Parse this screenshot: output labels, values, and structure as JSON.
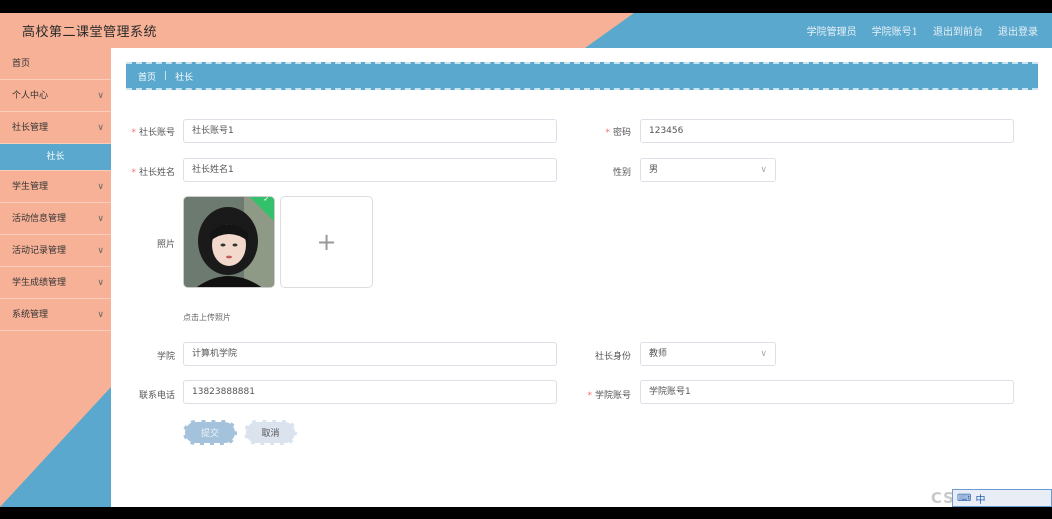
{
  "header": {
    "title": "高校第二课堂管理系统",
    "user_role": "学院管理员",
    "user_account": "学院账号1",
    "front_link": "退出到前台",
    "logout_link": "退出登录"
  },
  "sidebar": {
    "items": [
      {
        "label": "首页",
        "has_chevron": false
      },
      {
        "label": "个人中心",
        "has_chevron": true
      },
      {
        "label": "社长管理",
        "has_chevron": true
      },
      {
        "label": "社长",
        "sub": true
      },
      {
        "label": "学生管理",
        "has_chevron": true
      },
      {
        "label": "活动信息管理",
        "has_chevron": true
      },
      {
        "label": "活动记录管理",
        "has_chevron": true
      },
      {
        "label": "学生成绩管理",
        "has_chevron": true
      },
      {
        "label": "系统管理",
        "has_chevron": true
      }
    ]
  },
  "breadcrumb": {
    "home": "首页",
    "separator": "|",
    "current": "社长"
  },
  "form": {
    "account_label": "社长账号",
    "account_value": "社长账号1",
    "password_label": "密码",
    "password_value": "123456",
    "name_label": "社长姓名",
    "name_value": "社长姓名1",
    "gender_label": "性别",
    "gender_value": "男",
    "photo_label": "照片",
    "upload_plus": "+",
    "upload_tip": "点击上传照片",
    "college_label": "学院",
    "college_value": "计算机学院",
    "identity_label": "社长身份",
    "identity_value": "教师",
    "phone_label": "联系电话",
    "phone_value": "13823888881",
    "college_account_label": "学院账号",
    "college_account_value": "学院账号1",
    "submit_label": "提交",
    "cancel_label": "取消"
  },
  "overlay": {
    "watermark": "CSDN",
    "tray_text": "中"
  },
  "colors": {
    "peach": "#f6b197",
    "blue": "#5aa8cd",
    "required": "#f56c6c"
  }
}
